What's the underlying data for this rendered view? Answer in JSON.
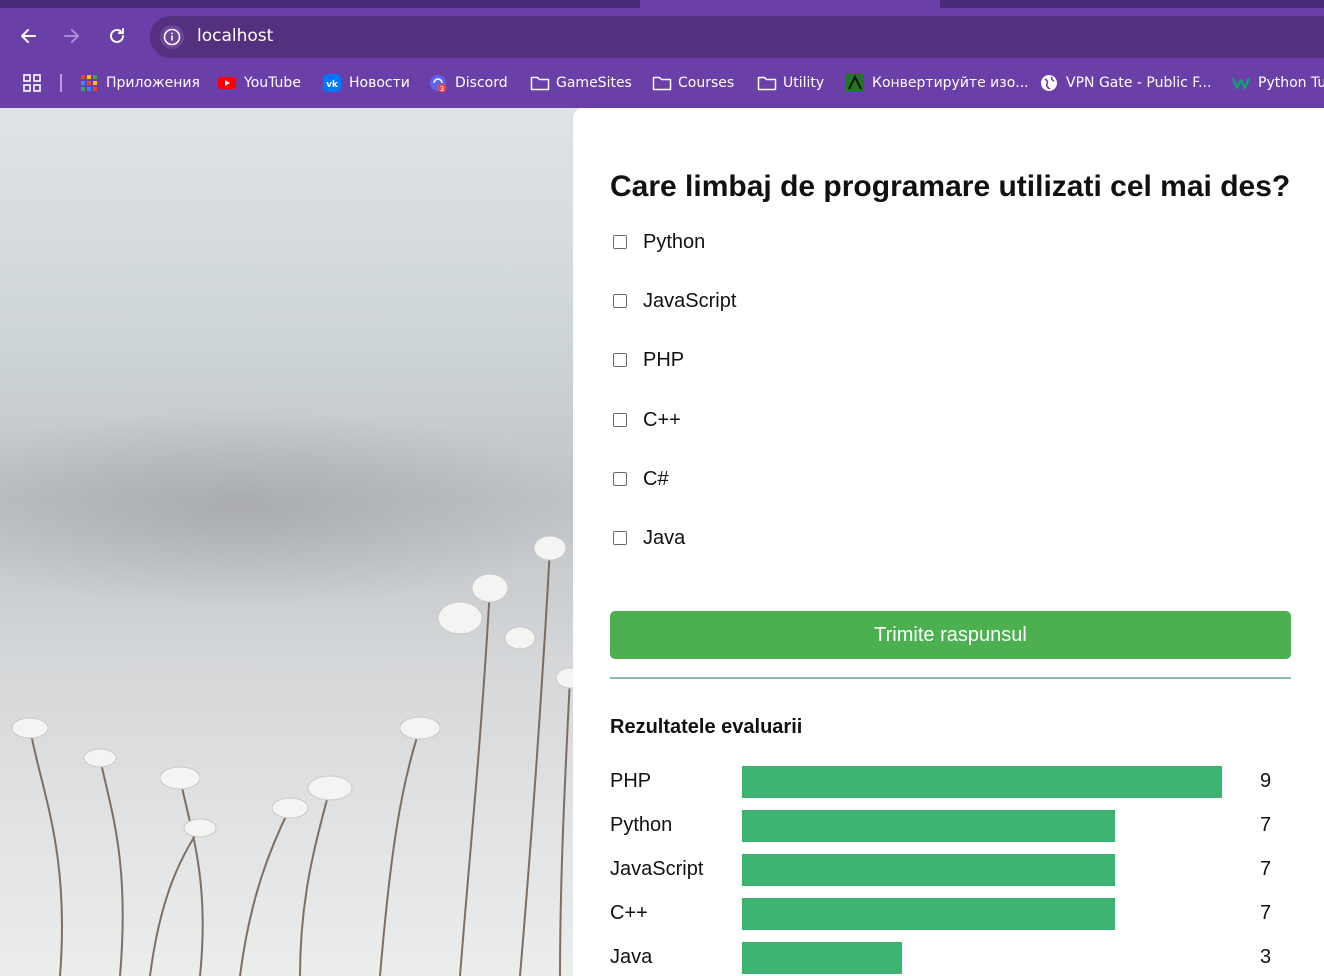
{
  "browser": {
    "url": "localhost",
    "bookmarks": [
      {
        "label": "Приложения",
        "icon": "apps-grid-icon"
      },
      {
        "label": "YouTube",
        "icon": "youtube-icon"
      },
      {
        "label": "Новости",
        "icon": "vk-icon"
      },
      {
        "label": "Discord",
        "icon": "discord-icon",
        "badge": "3"
      },
      {
        "label": "GameSites",
        "icon": "folder-icon"
      },
      {
        "label": "Courses",
        "icon": "folder-icon"
      },
      {
        "label": "Utility",
        "icon": "folder-icon"
      },
      {
        "label": "Конвертируйте изо...",
        "icon": "converter-icon"
      },
      {
        "label": "VPN Gate - Public F...",
        "icon": "globe-icon"
      },
      {
        "label": "Python Tu",
        "icon": "w-icon"
      }
    ]
  },
  "poll": {
    "question": "Care limbaj de programare utilizati cel mai des?",
    "options": [
      {
        "label": "Python",
        "checked": false
      },
      {
        "label": "JavaScript",
        "checked": false
      },
      {
        "label": "PHP",
        "checked": false
      },
      {
        "label": "C++",
        "checked": false
      },
      {
        "label": "C#",
        "checked": false
      },
      {
        "label": "Java",
        "checked": false
      }
    ],
    "submit_label": "Trimite raspunsul"
  },
  "results": {
    "title": "Rezultatele evaluarii",
    "max": 9,
    "items": [
      {
        "label": "PHP",
        "count": 9
      },
      {
        "label": "Python",
        "count": 7
      },
      {
        "label": "JavaScript",
        "count": 7
      },
      {
        "label": "C++",
        "count": 7
      },
      {
        "label": "Java",
        "count": 3
      }
    ]
  },
  "colors": {
    "chrome": "#6b3fa8",
    "submit": "#4caf50",
    "bar": "#3cb371"
  }
}
